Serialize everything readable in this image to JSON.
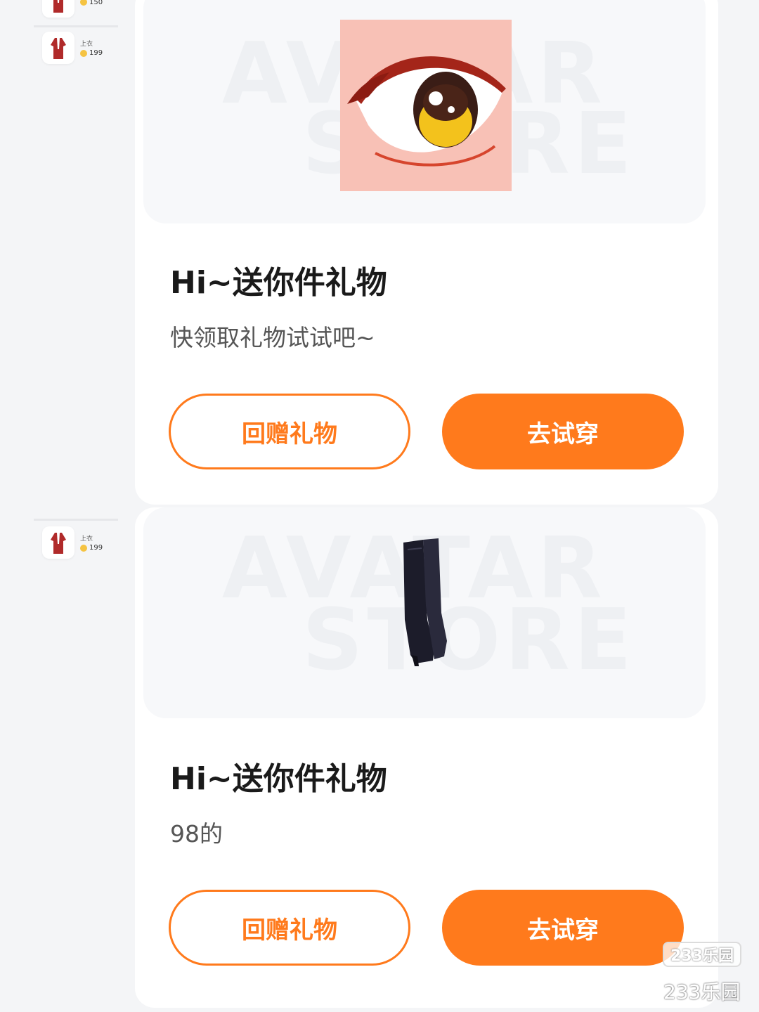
{
  "side_list": {
    "items": [
      {
        "category": "",
        "price": "150"
      },
      {
        "category": "上衣",
        "price": "199"
      },
      {
        "category": "上衣",
        "price": "199"
      }
    ]
  },
  "watermark": {
    "line1": "AVATAR",
    "line2": "STORE"
  },
  "gifts": [
    {
      "title": "Hi~送你件礼物",
      "message": "快领取礼物试试吧~",
      "return_gift_label": "回赠礼物",
      "try_on_label": "去试穿",
      "item_icon": "eye-icon"
    },
    {
      "title": "Hi~送你件礼物",
      "message": "98的",
      "return_gift_label": "回赠礼物",
      "try_on_label": "去试穿",
      "item_icon": "boots-icon"
    }
  ],
  "site_logo": {
    "badge": "233乐园",
    "text": "233乐园"
  },
  "colors": {
    "accent": "#ff7a1c",
    "background": "#f4f5f7",
    "card": "#ffffff"
  }
}
